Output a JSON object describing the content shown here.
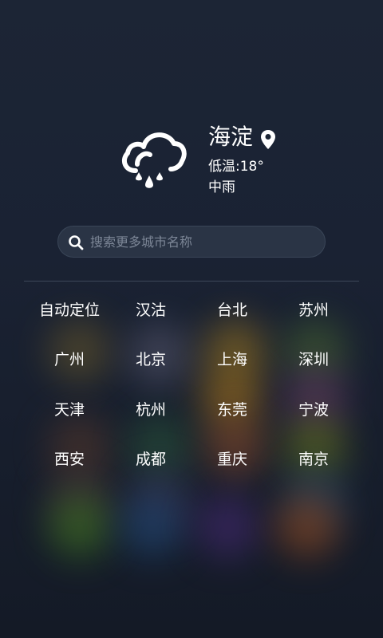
{
  "weather": {
    "city": "海淀",
    "low_temp": "低温:18°",
    "condition": "中雨",
    "icon": "cloud-rain-icon"
  },
  "search": {
    "placeholder": "搜索更多城市名称",
    "value": ""
  },
  "cities": [
    "自动定位",
    "汉沽",
    "台北",
    "苏州",
    "广州",
    "北京",
    "上海",
    "深圳",
    "天津",
    "杭州",
    "东莞",
    "宁波",
    "西安",
    "成都",
    "重庆",
    "南京"
  ],
  "colors": {
    "background": "#1a2233",
    "text": "#ffffff",
    "search_bg": "#2a3445",
    "placeholder": "#7c8696",
    "divider": "#3d4758"
  }
}
